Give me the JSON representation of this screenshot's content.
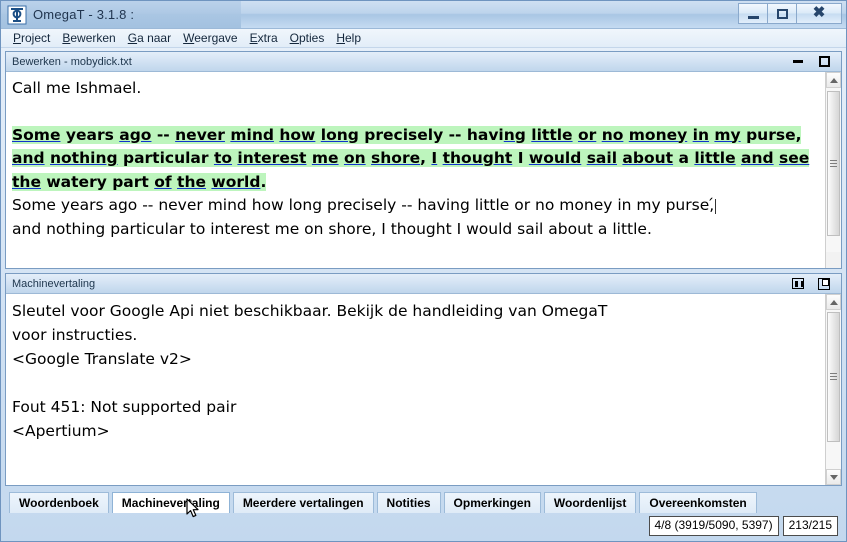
{
  "window": {
    "title": "OmegaT - 3.1.8 :",
    "logo_icon": "omegat-logo-icon",
    "minimize_label": "Minimaliseren",
    "maximize_label": "Maximaliseren",
    "close_label": "Sluiten"
  },
  "menubar": {
    "items": [
      {
        "label": "Project",
        "mnemonic": "P",
        "rest": "roject"
      },
      {
        "label": "Bewerken",
        "mnemonic": "B",
        "rest": "ewerken"
      },
      {
        "label": "Ga naar",
        "mnemonic": "G",
        "rest": "a naar"
      },
      {
        "label": "Weergave",
        "mnemonic": "W",
        "rest": "eergave"
      },
      {
        "label": "Extra",
        "mnemonic": "E",
        "rest": "xtra"
      },
      {
        "label": "Opties",
        "mnemonic": "O",
        "rest": "pties"
      },
      {
        "label": "Help",
        "mnemonic": "H",
        "rest": "elp"
      }
    ]
  },
  "editor_panel": {
    "title": "Bewerken - mobydick.txt",
    "buttons": [
      "minimize-icon",
      "maximize-icon"
    ],
    "content": {
      "line1": "Call me Ishmael.",
      "active_segment_source": "Some years ago -- never mind how long precisely -- having little or no money in my purse, and nothing particular to interest me on shore, I thought I would sail about a little and see the watery part of the world.",
      "active_segment_tokens": [
        {
          "t": "Some",
          "u": true
        },
        {
          "t": " ",
          "u": false
        },
        {
          "t": "years",
          "u": false
        },
        {
          "t": " ",
          "u": false
        },
        {
          "t": "ago",
          "u": true
        },
        {
          "t": " -- ",
          "u": false
        },
        {
          "t": "never",
          "u": true
        },
        {
          "t": " ",
          "u": false
        },
        {
          "t": "mind",
          "u": true
        },
        {
          "t": " ",
          "u": false
        },
        {
          "t": "how",
          "u": true
        },
        {
          "t": " ",
          "u": false
        },
        {
          "t": "long",
          "u": true
        },
        {
          "t": " precisely -- havi",
          "u": false
        },
        {
          "t": "ng",
          "u": true
        },
        {
          "t": " ",
          "u": false
        },
        {
          "t": "little",
          "u": true
        },
        {
          "t": " ",
          "u": false
        },
        {
          "t": "or",
          "u": true
        },
        {
          "t": " ",
          "u": false
        },
        {
          "t": "no",
          "u": true
        },
        {
          "t": " ",
          "u": false
        },
        {
          "t": "money",
          "u": true
        },
        {
          "t": " ",
          "u": false
        },
        {
          "t": "in",
          "u": true
        },
        {
          "t": " ",
          "u": false
        },
        {
          "t": "my",
          "u": true
        },
        {
          "t": " purse, ",
          "u": false
        },
        {
          "t": "and",
          "u": true
        },
        {
          "t": " ",
          "u": false
        },
        {
          "t": "nothing",
          "u": true
        },
        {
          "t": " particular ",
          "u": false
        },
        {
          "t": "to",
          "u": true
        },
        {
          "t": " ",
          "u": false
        },
        {
          "t": "interest",
          "u": true
        },
        {
          "t": " ",
          "u": false
        },
        {
          "t": "me",
          "u": true
        },
        {
          "t": " ",
          "u": false
        },
        {
          "t": "on",
          "u": true
        },
        {
          "t": " ",
          "u": false
        },
        {
          "t": "shore",
          "u": true
        },
        {
          "t": ", ",
          "u": false
        },
        {
          "t": "I",
          "u": true
        },
        {
          "t": " ",
          "u": false
        },
        {
          "t": "thought",
          "u": true
        },
        {
          "t": " ",
          "u": false
        },
        {
          "t": "I",
          "u": false
        },
        {
          "t": " ",
          "u": false
        },
        {
          "t": "would",
          "u": true
        },
        {
          "t": " ",
          "u": false
        },
        {
          "t": "sail",
          "u": true
        },
        {
          "t": " ",
          "u": false
        },
        {
          "t": "about",
          "u": true
        },
        {
          "t": " a ",
          "u": false
        },
        {
          "t": "little",
          "u": true
        },
        {
          "t": " ",
          "u": false
        },
        {
          "t": "and",
          "u": true
        },
        {
          "t": " ",
          "u": false
        },
        {
          "t": "see",
          "u": true
        },
        {
          "t": " ",
          "u": false
        },
        {
          "t": "the",
          "u": true
        },
        {
          "t": " watery part ",
          "u": false
        },
        {
          "t": "of",
          "u": true
        },
        {
          "t": " ",
          "u": false
        },
        {
          "t": "the",
          "u": true
        },
        {
          "t": " ",
          "u": false
        },
        {
          "t": "world",
          "u": true
        },
        {
          "t": ".",
          "u": false
        }
      ],
      "target_line_1": "Some years ago -- never mind how long precisely -- having little or no money in my purse,",
      "target_line_2": "and nothing particular to interest me on shore, I thought I would sail about a little."
    },
    "scrollbar": {
      "thumb_top_pct": 4,
      "thumb_height_pct": 86
    }
  },
  "mt_panel": {
    "title": "Machinevertaling",
    "buttons": [
      "restore-icon",
      "undock-icon"
    ],
    "lines": [
      "Sleutel voor Google Api niet beschikbaar. Bekijk de handleiding van OmegaT",
      "voor instructies.",
      "<Google Translate v2>",
      "",
      "Fout 451: Not supported pair",
      "<Apertium>"
    ],
    "scrollbar": {
      "thumb_top_pct": 2,
      "thumb_height_pct": 80
    }
  },
  "tabs": {
    "active": "Machinevertaling",
    "items": [
      {
        "label": "Woordenboek",
        "active": false
      },
      {
        "label": "Machinevertaling",
        "active": true
      },
      {
        "label": "Meerdere vertalingen",
        "active": false
      },
      {
        "label": "Notities",
        "active": false
      },
      {
        "label": "Opmerkingen",
        "active": false
      },
      {
        "label": "Woordenlijst",
        "active": false
      },
      {
        "label": "Overeenkomsten",
        "active": false
      }
    ]
  },
  "statusbar": {
    "progress": "4/8 (3919/5090, 5397)",
    "segment_counter": "213/215"
  },
  "colors": {
    "segment_highlight": "#bdf5bd",
    "underline": "#1133cc",
    "window_chrome": "#c3d8ee",
    "accent_border": "#7a9cc2"
  }
}
